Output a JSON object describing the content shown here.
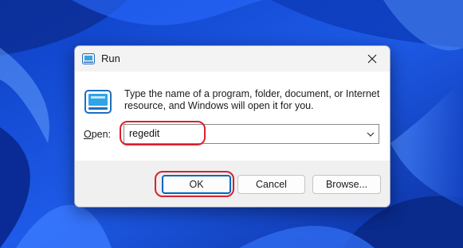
{
  "dialog": {
    "title": "Run",
    "title_icon": "run-icon",
    "close_icon": "close-icon",
    "message": "Type the name of a program, folder, document, or Internet resource, and Windows will open it for you.",
    "open_label_accel": "O",
    "open_label_rest": "pen:",
    "open_value": "regedit",
    "buttons": {
      "ok": "OK",
      "cancel": "Cancel",
      "browse": "Browse..."
    }
  },
  "colors": {
    "highlight": "#d9212f",
    "accent": "#0067c0",
    "wallpaper": "#1f56d6"
  }
}
